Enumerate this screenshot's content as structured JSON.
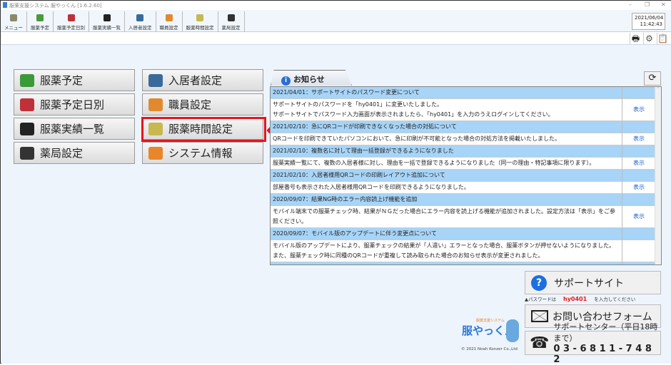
{
  "window": {
    "title": "服薬支援システム 服やっくん [1.6.2.60]",
    "min": "–",
    "max": "❐",
    "close": "✕"
  },
  "toolbar": [
    {
      "label": "メニュー",
      "color": "#8a8a6a"
    },
    {
      "label": "服薬予定",
      "color": "#4a9a3a"
    },
    {
      "label": "服薬予定日別",
      "color": "#c0303a"
    },
    {
      "label": "服薬実績一覧",
      "color": "#222"
    },
    {
      "label": "入居者設定",
      "color": "#3a6a9a"
    },
    {
      "label": "職員設定",
      "color": "#e08a30"
    },
    {
      "label": "服薬時間設定",
      "color": "#c8b850"
    },
    {
      "label": "薬局設定",
      "color": "#333"
    }
  ],
  "clock": {
    "date": "2021/06/04",
    "time": "11:42:43"
  },
  "menu": {
    "left": [
      "服薬予定",
      "服薬予定日別",
      "服薬実績一覧",
      "薬局設定"
    ],
    "right": [
      "入居者設定",
      "職員設定",
      "服薬時間設定",
      "システム情報"
    ]
  },
  "news": {
    "tab": "お知らせ",
    "link": "表示",
    "items": [
      {
        "title": "2021/04/01：サポートサイトのパスワード変更について",
        "body": "サポートサイトのパスワードを「hy0401」に変更いたしました。\nサポートサイトでパスワード入力画面が表示されましたら、「hy0401」を入力のうえログインしてください。",
        "link": true
      },
      {
        "title": "2021/02/10：急にQRコードが印刷できなくなった場合の対処について",
        "body": "QRコードを印刷できていたパソコンにおいて、急に印刷が不可能となった場合の対処方法を掲載いたしました。",
        "link": true
      },
      {
        "title": "2021/02/10：複数名に対して理由一括登録ができるようになりました",
        "body": "服薬実績一覧にて、複数の入居者様に対し、理由を一括で登録できるようになりました（同一の理由・特記事項に限ります）。",
        "link": true
      },
      {
        "title": "2021/02/10：入居者様用QRコードの印刷レイアウト追加について",
        "body": "部屋番号も表示された入居者様用QRコードを印刷できるようになりました。",
        "link": true
      },
      {
        "title": "2020/09/07：結果NG時のエラー内容読上げ機能を追加",
        "body": "モバイル端末での服薬チェック時、結果がＮＧだった場合にエラー内容を読上げる機能が追加されました。設定方法は「表示」をご参照ください。",
        "link": true
      },
      {
        "title": "2020/09/07：モバイル版のアップデートに伴う変更点について",
        "body": "モバイル版のアップデートにより、服薬チェックの結果が「人違い」エラーとなった場合、服薬ボタンが押せないようになりました。また、服薬チェック時に同種のQRコードが重複して読み取られた場合のお知らせ表示が変更されました。",
        "link": false
      },
      {
        "title": "2020/07/30：グループ編集画面のレイアウト変更について",
        "body": "",
        "link": false
      }
    ]
  },
  "support": {
    "site": "サポートサイト",
    "pw_prefix": "▲パスワードは",
    "pw": "hy0401",
    "pw_suffix": "を入力してください",
    "form": "お問い合わせフォーム",
    "center": "サポートセンター（平日18時まで）",
    "phone": "0 3 - 6 8 1 1 - 7 4 8 2"
  },
  "logo": {
    "name": "服やっくん",
    "sub": "服薬支援システム",
    "copyright": "© 2021  Noah Konzer Co.,Ltd"
  }
}
